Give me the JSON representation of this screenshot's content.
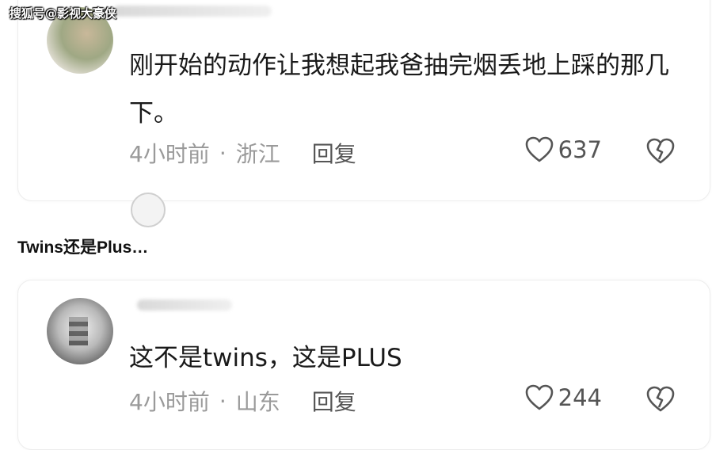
{
  "watermark": "搜狐号@影视大豪侠",
  "comments": [
    {
      "text": "刚开始的动作让我想起我爸抽完烟丢地上踩的那几下。",
      "time": "4小时前",
      "location": "浙江",
      "reply_label": "回复",
      "likes": "637"
    },
    {
      "text": "这不是twins，这是PLUS",
      "time": "4小时前",
      "location": "山东",
      "reply_label": "回复",
      "likes": "244"
    }
  ],
  "section_heading": "Twins还是Plus…",
  "separator": "·",
  "icons": {
    "like": "heart-icon",
    "dislike": "broken-heart-icon"
  },
  "colors": {
    "meta_text": "#9a9a9a",
    "body_text": "#1a1a1a",
    "card_border": "#ededed"
  }
}
